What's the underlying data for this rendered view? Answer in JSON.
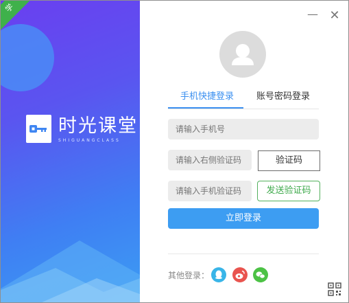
{
  "ribbon": {
    "label": "学"
  },
  "brand": {
    "name_cn": "时光课堂",
    "name_en": "SHIGUANGCLASS"
  },
  "window_controls": {
    "minimize": "—",
    "close": "✕"
  },
  "tabs": [
    {
      "label": "手机快捷登录",
      "active": true
    },
    {
      "label": "账号密码登录",
      "active": false
    }
  ],
  "form": {
    "phone_placeholder": "请输入手机号",
    "captcha_placeholder": "请输入右侧验证码",
    "captcha_button": "验证码",
    "sms_placeholder": "请输入手机验证码",
    "send_code_button": "发送验证码",
    "login_button": "立即登录"
  },
  "other_login": {
    "label": "其他登录：",
    "providers": [
      "qq-icon",
      "weibo-icon",
      "wechat-icon"
    ]
  },
  "colors": {
    "accent": "#3d9df2",
    "green": "#3faa4c",
    "qq": "#39b5e8",
    "weibo": "#e9544f",
    "wechat": "#4cc245"
  }
}
